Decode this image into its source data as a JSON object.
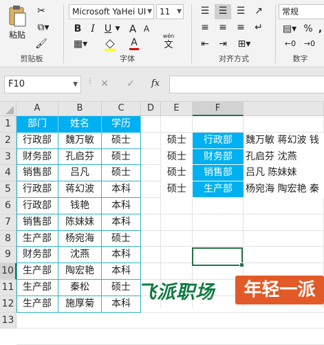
{
  "ribbon": {
    "clipboard": {
      "paste_label": "粘贴",
      "group_label": "剪贴板"
    },
    "font": {
      "family": "Microsoft YaHei UI",
      "size": "11",
      "group_label": "字体",
      "pinyin_label": "wén",
      "bold": "B",
      "italic": "I",
      "underline": "U",
      "grow": "A",
      "shrink": "A",
      "font_color": "A",
      "pinyin_char": "文"
    },
    "alignment": {
      "group_label": "对齐方式"
    },
    "number": {
      "format": "常规",
      "group_label": "数字",
      "percent": "%",
      "comma": ","
    }
  },
  "formula_bar": {
    "name_box": "F10",
    "fx": "fx",
    "cancel": "✕",
    "confirm": "✓",
    "formula": ""
  },
  "sheet": {
    "columns": [
      "A",
      "B",
      "C",
      "D",
      "E",
      "F"
    ],
    "rows": [
      "1",
      "2",
      "3",
      "4",
      "5",
      "6",
      "7",
      "8",
      "9",
      "10",
      "11",
      "12",
      "13"
    ],
    "headers": [
      "部门",
      "姓名",
      "学历"
    ],
    "table": [
      [
        "行政部",
        "魏万敏",
        "硕士"
      ],
      [
        "财务部",
        "孔启芬",
        "硕士"
      ],
      [
        "销售部",
        "吕凡",
        "硕士"
      ],
      [
        "行政部",
        "蒋幻波",
        "本科"
      ],
      [
        "行政部",
        "钱艳",
        "本科"
      ],
      [
        "销售部",
        "陈妹妹",
        "本科"
      ],
      [
        "生产部",
        "杨宛海",
        "硕士"
      ],
      [
        "财务部",
        "沈燕",
        "本科"
      ],
      [
        "生产部",
        "陶宏艳",
        "本科"
      ],
      [
        "生产部",
        "秦松",
        "硕士"
      ],
      [
        "生产部",
        "施厚菊",
        "本科"
      ]
    ],
    "summary": [
      {
        "degree": "硕士",
        "dept": "行政部",
        "names": "魏万敏 蒋幻波 钱"
      },
      {
        "degree": "硕士",
        "dept": "财务部",
        "names": "孔启芬 沈燕"
      },
      {
        "degree": "硕士",
        "dept": "销售部",
        "names": "吕凡 陈妹妹"
      },
      {
        "degree": "硕士",
        "dept": "生产部",
        "names": "杨宛海 陶宏艳 秦"
      }
    ],
    "selected_cell": "F10"
  },
  "watermark": {
    "text_left": "飞派职场",
    "text_right": "年轻一派"
  },
  "colors": {
    "accent": "#00b0f0",
    "selection": "#217346",
    "watermark_left": "#0f7a3f",
    "watermark_right": "#e25a27"
  }
}
